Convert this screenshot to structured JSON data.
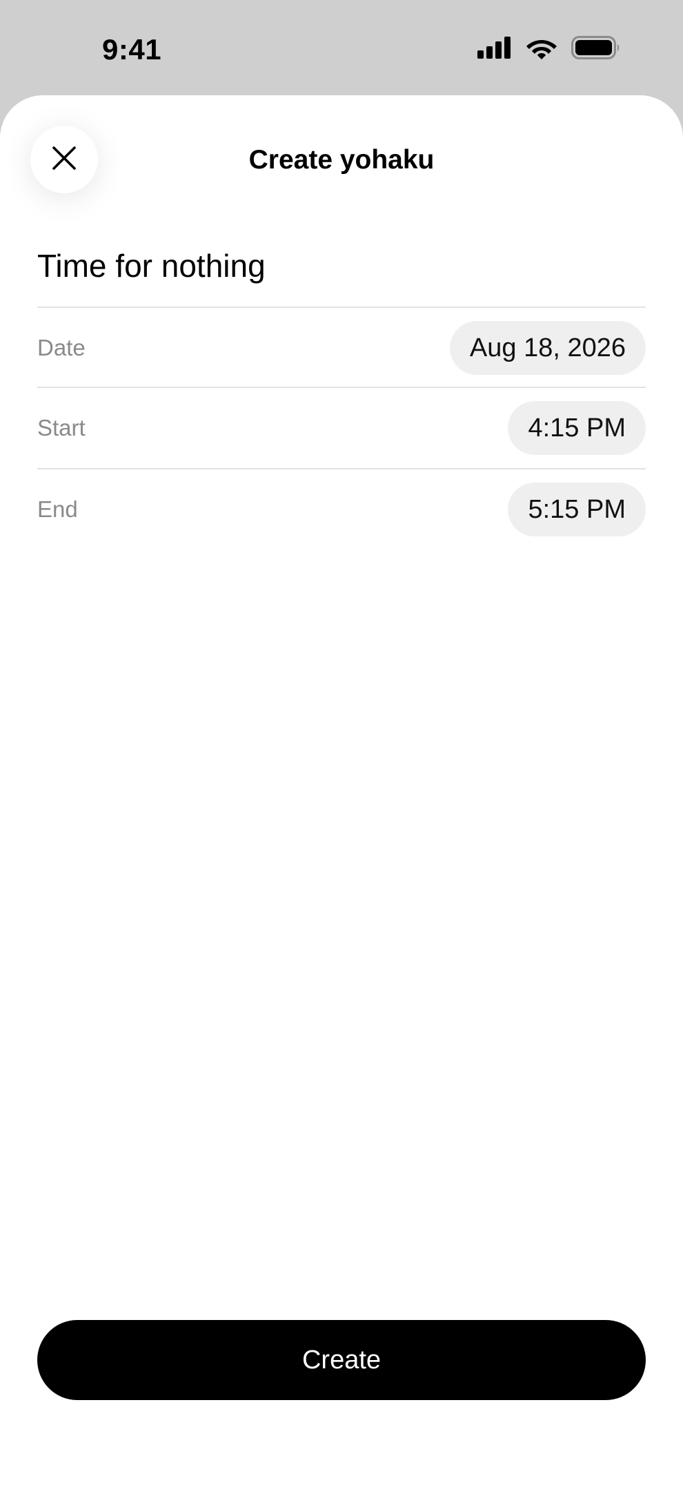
{
  "status_bar": {
    "time": "9:41"
  },
  "header": {
    "title": "Create yohaku"
  },
  "form": {
    "event_title": "Time for nothing",
    "date": {
      "label": "Date",
      "value": "Aug 18, 2026"
    },
    "start": {
      "label": "Start",
      "value": "4:15 PM"
    },
    "end": {
      "label": "End",
      "value": "5:15 PM"
    }
  },
  "footer": {
    "create_label": "Create"
  },
  "colors": {
    "background_dim": "#cfcfcf",
    "sheet": "#ffffff",
    "pill": "#efefef",
    "divider": "#e2e2e2",
    "label_gray": "#8a8a8a",
    "primary_button": "#000000"
  }
}
